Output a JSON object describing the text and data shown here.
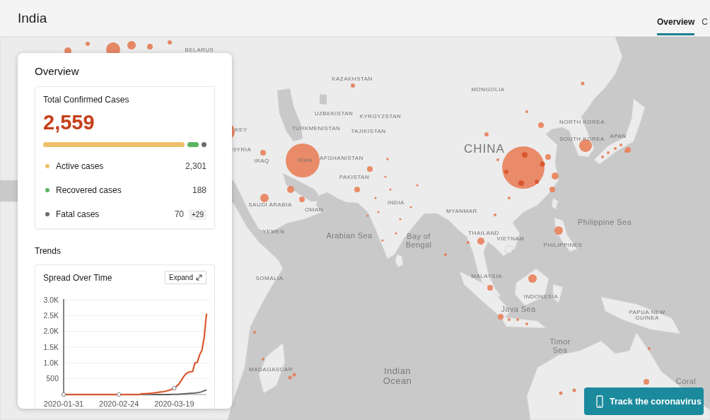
{
  "header": {
    "title": "India",
    "tabs": [
      {
        "label": "Overview",
        "selected": true
      },
      {
        "label": "C",
        "selected": false
      }
    ]
  },
  "overview": {
    "title": "Overview",
    "summary": {
      "label": "Total Confirmed Cases",
      "total": "2,559",
      "breakdown": [
        {
          "label": "Active cases",
          "value": "2,301",
          "color": "#edc16a"
        },
        {
          "label": "Recovered cases",
          "value": "188",
          "color": "#5cb461"
        },
        {
          "label": "Fatal cases",
          "value": "70",
          "change": "+29",
          "color": "#6b6b6b"
        }
      ]
    },
    "trends": {
      "title": "Trends",
      "expand_label": "Expand",
      "chart_data": {
        "type": "line",
        "title": "Spread Over Time",
        "grid": true,
        "categories": [
          "2020-01-31",
          null,
          null,
          null,
          null,
          null,
          null,
          null,
          null,
          null,
          null,
          null,
          null,
          null,
          null,
          null,
          null,
          null,
          null,
          null,
          null,
          null,
          null,
          null,
          "2020-02-24",
          null,
          null,
          null,
          null,
          null,
          null,
          null,
          null,
          null,
          null,
          null,
          null,
          null,
          null,
          null,
          null,
          null,
          null,
          null,
          null,
          null,
          null,
          null,
          "2020-03-19",
          null,
          null,
          null,
          null,
          null,
          null,
          null,
          null,
          null,
          null,
          null,
          null,
          null,
          null
        ],
        "series": [
          {
            "color": "#d2461c",
            "values": [
              0,
              0,
              0,
              0,
              0,
              0,
              0,
              0,
              0,
              0,
              0,
              0,
              0,
              0,
              0,
              0,
              0,
              0,
              0,
              0,
              0,
              0,
              0,
              0,
              0,
              0,
              0,
              0,
              0,
              0,
              0,
              0,
              0,
              0,
              30,
              30,
              30,
              40,
              40,
              50,
              60,
              70,
              80,
              90,
              100,
              120,
              140,
              170,
              200,
              260,
              330,
              440,
              560,
              650,
              700,
              720,
              730,
              1000,
              1020,
              1250,
              1400,
              1800,
              2560
            ]
          },
          {
            "color": "#5a5a5a",
            "values": [
              0,
              0,
              0,
              0,
              0,
              0,
              0,
              0,
              0,
              0,
              0,
              0,
              0,
              0,
              0,
              0,
              0,
              0,
              0,
              0,
              0,
              0,
              0,
              0,
              0,
              0,
              0,
              0,
              0,
              0,
              0,
              0,
              0,
              0,
              0,
              0,
              0,
              0,
              0,
              0,
              0,
              0,
              0,
              0,
              0,
              0,
              0,
              10,
              10,
              10,
              10,
              20,
              20,
              30,
              30,
              40,
              40,
              50,
              60,
              70,
              90,
              120,
              150
            ]
          }
        ],
        "ylim": [
          0,
          3000
        ],
        "yticks": [
          {
            "value": 500,
            "label": "500"
          },
          {
            "value": 1000,
            "label": "1.0K"
          },
          {
            "value": 1500,
            "label": "1.5K"
          },
          {
            "value": 2000,
            "label": "2.0K"
          },
          {
            "value": 2500,
            "label": "2.5K"
          },
          {
            "value": 3000,
            "label": "3.0K"
          }
        ]
      }
    }
  },
  "map": {
    "labels": [
      {
        "text": "BELARUS",
        "kind": "country"
      },
      {
        "text": "KAZAKHSTAN",
        "kind": "country"
      },
      {
        "text": "MONGOLIA",
        "kind": "country"
      },
      {
        "text": "UZBEKISTAN",
        "kind": "country"
      },
      {
        "text": "KYRGYZSTAN",
        "kind": "country"
      },
      {
        "text": "NORTH KOREA",
        "kind": "country"
      },
      {
        "text": "KEY",
        "kind": "country"
      },
      {
        "text": "TURKMENISTAN",
        "kind": "country"
      },
      {
        "text": "TAJIKISTAN",
        "kind": "country"
      },
      {
        "text": "SOUTH KOREA",
        "kind": "country"
      },
      {
        "text": "APAN",
        "kind": "country"
      },
      {
        "text": "SYRIA",
        "kind": "country"
      },
      {
        "text": "CHINA",
        "kind": "country_large"
      },
      {
        "text": "IRAQ",
        "kind": "country"
      },
      {
        "text": "IRAN",
        "kind": "country"
      },
      {
        "text": "AFGHANISTAN",
        "kind": "country"
      },
      {
        "text": "PAKISTAN",
        "kind": "country"
      },
      {
        "text": "SAUDI ARABIA",
        "kind": "country"
      },
      {
        "text": "INDIA",
        "kind": "country"
      },
      {
        "text": "OMAN",
        "kind": "country"
      },
      {
        "text": "MYANMAR",
        "kind": "country"
      },
      {
        "text": "Philippine Sea",
        "kind": "sea"
      },
      {
        "text": "YEMEN",
        "kind": "country"
      },
      {
        "text": "Arabian Sea",
        "kind": "sea"
      },
      {
        "text": "Bay of Bengal",
        "kind": "sea"
      },
      {
        "text": "THAILAND",
        "kind": "country"
      },
      {
        "text": "VIETNAM",
        "kind": "country"
      },
      {
        "text": "PHILIPPINES",
        "kind": "country"
      },
      {
        "text": "SOMALIA",
        "kind": "country"
      },
      {
        "text": "MALAYSIA",
        "kind": "country"
      },
      {
        "text": "INDONESIA",
        "kind": "country"
      },
      {
        "text": "Java Sea",
        "kind": "sea"
      },
      {
        "text": "PAPUA NEW GUINEA",
        "kind": "country"
      },
      {
        "text": "Timor Sea",
        "kind": "sea"
      },
      {
        "text": "MADAGASCAR",
        "kind": "country"
      },
      {
        "text": "Indian Ocean",
        "kind": "ocean"
      },
      {
        "text": "Coral",
        "kind": "sea"
      }
    ]
  },
  "track_button": {
    "label": "Track the coronavirus"
  }
}
